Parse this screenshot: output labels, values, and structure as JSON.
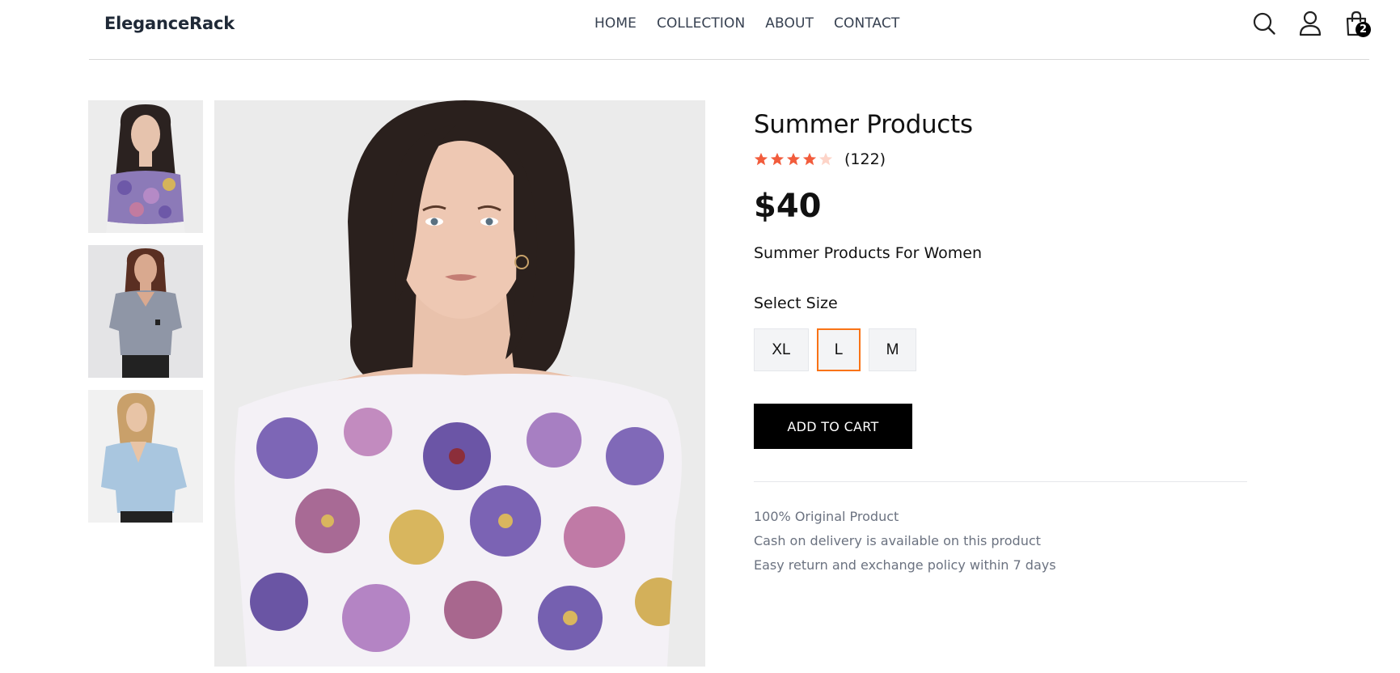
{
  "brand": {
    "logo": "EleganceRack"
  },
  "nav": {
    "items": [
      {
        "label": "HOME"
      },
      {
        "label": "COLLECTION"
      },
      {
        "label": "ABOUT"
      },
      {
        "label": "CONTACT"
      }
    ]
  },
  "header_icons": {
    "search": "search-icon",
    "profile": "user-icon",
    "cart": "shopping-bag-icon",
    "cart_count": "2"
  },
  "product": {
    "title": "Summer Products",
    "rating": 4,
    "rating_max": 5,
    "review_count": "(122)",
    "price": "$40",
    "description": "Summer Products For Women",
    "size_label": "Select Size",
    "sizes": [
      {
        "label": "XL",
        "selected": false
      },
      {
        "label": "L",
        "selected": true
      },
      {
        "label": "M",
        "selected": false
      }
    ],
    "add_to_cart_label": "ADD TO CART",
    "policies": [
      "100% Original Product",
      "Cash on delivery is available on this product",
      "Easy return and exchange policy within 7 days"
    ]
  },
  "gallery": {
    "thumbnails": [
      "floral-off-shoulder-top",
      "grey-v-neck-tee",
      "light-blue-shirt"
    ],
    "main_image": "floral-off-shoulder-top"
  },
  "colors": {
    "star_filled": "#f25c3c",
    "star_empty": "#fdd4c8",
    "selected_size_border": "#f97316",
    "cart_button": "#000000"
  }
}
